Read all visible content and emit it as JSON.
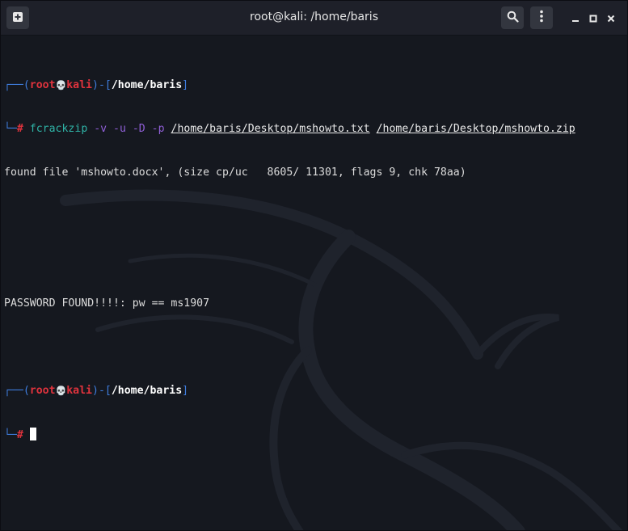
{
  "window": {
    "title": "root@kali: /home/baris"
  },
  "titlebar": {
    "new_tab_icon": "plus-square-icon",
    "search_icon": "search-icon",
    "menu_icon": "vertical-dots-icon",
    "minimize_icon": "minimize-icon",
    "maximize_icon": "maximize-icon",
    "close_icon": "close-icon"
  },
  "terminal": {
    "prompt1": {
      "corner_top": "┌──(",
      "user": "root",
      "skull": "💀",
      "host": "kali",
      "mid": ")-[",
      "dir": "/home/baris",
      "end": "]"
    },
    "command_line": {
      "corner_bottom": "└─",
      "hash": "#",
      "cmd": "fcrackzip",
      "opts": "-v -u -D -p",
      "wordlist": "/home/baris/Desktop/mshowto.txt",
      "zipfile": "/home/baris/Desktop/mshowto.zip"
    },
    "output": [
      "found file 'mshowto.docx', (size cp/uc   8605/ 11301, flags 9, chk 78aa)",
      "",
      "",
      "PASSWORD FOUND!!!!: pw == ms1907"
    ],
    "prompt2": {
      "corner_top": "┌──(",
      "user": "root",
      "skull": "💀",
      "host": "kali",
      "mid": ")-[",
      "dir": "/home/baris",
      "end": "]",
      "corner_bottom": "└─",
      "hash": "#"
    }
  },
  "colors": {
    "background": "#15181f",
    "prompt_blue": "#3f7dde",
    "prompt_red": "#e0333d",
    "command": "#2fb3a6",
    "options": "#8f5fd6"
  }
}
